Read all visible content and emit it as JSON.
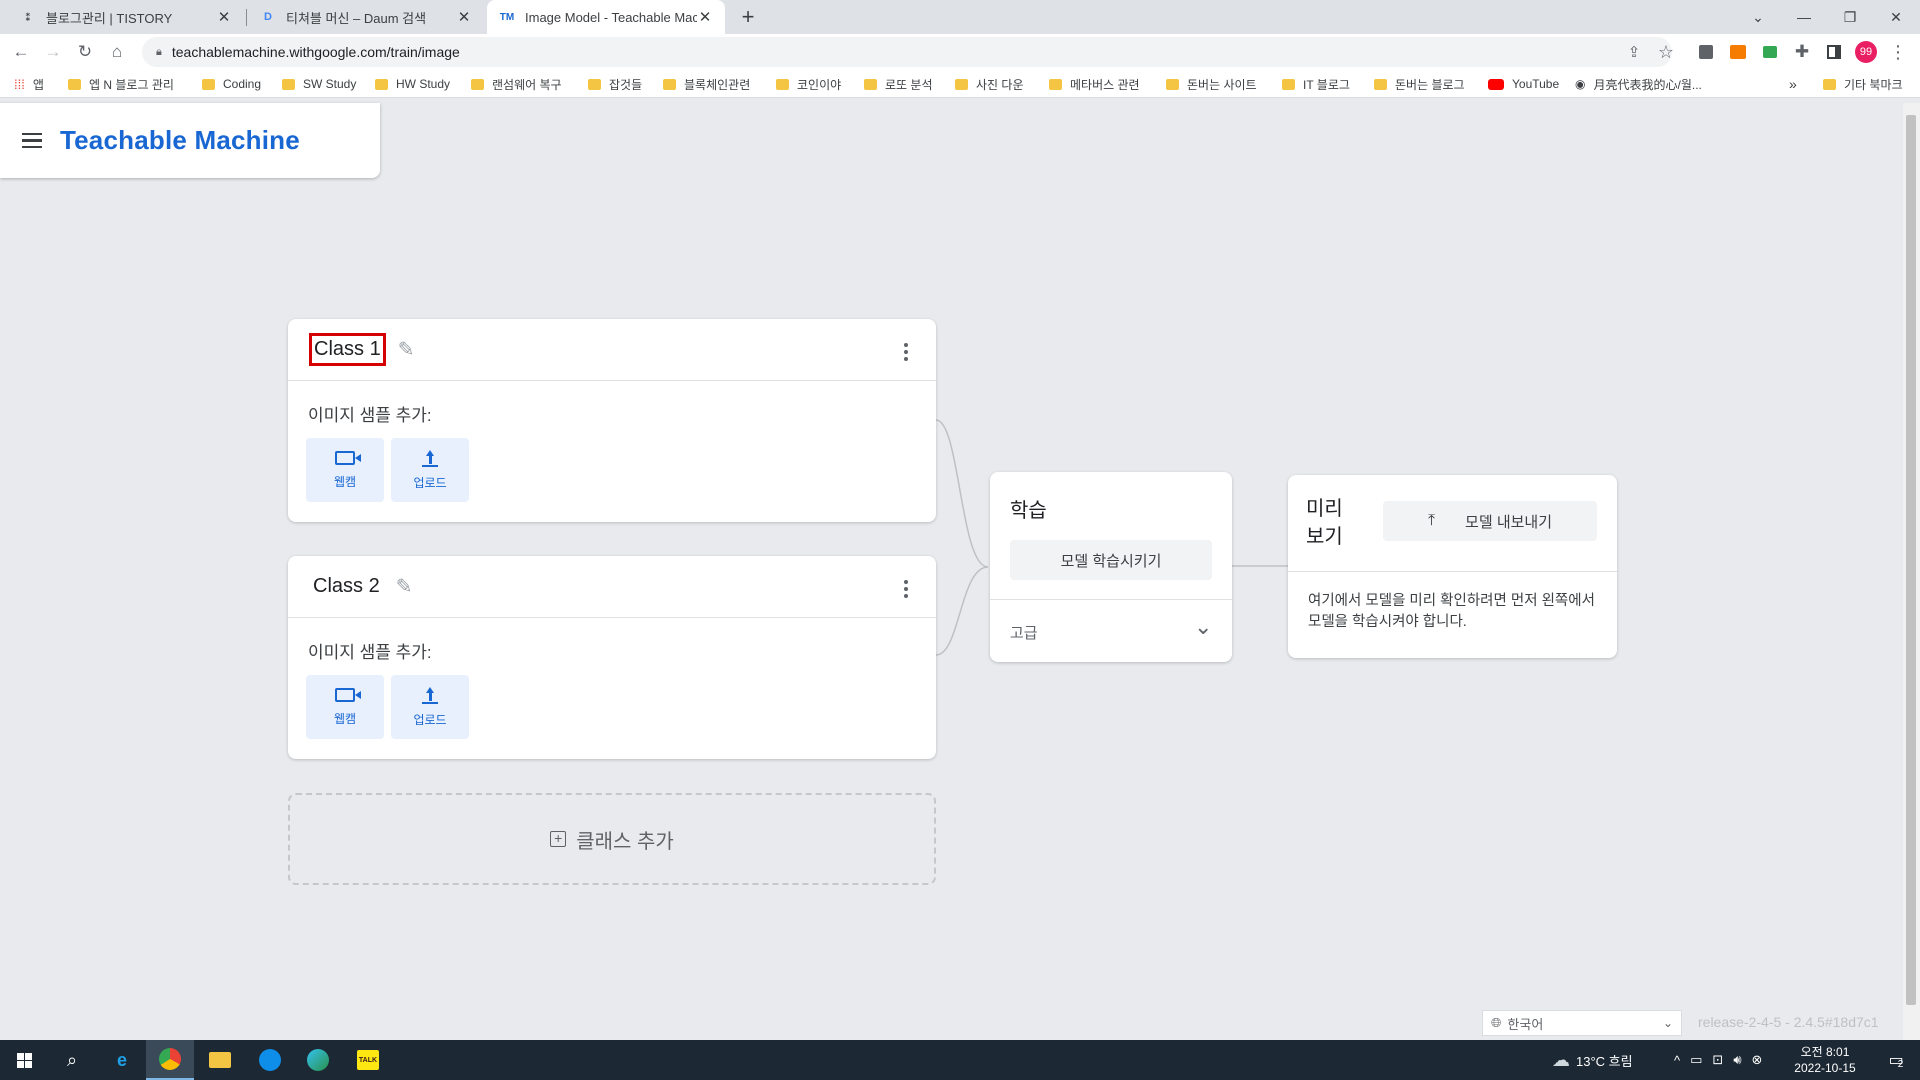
{
  "browser": {
    "tabs": [
      {
        "title": "블로그관리 | TISTORY"
      },
      {
        "title": "티쳐블 머신 – Daum 검색"
      },
      {
        "title": "Image Model - Teachable Mach"
      }
    ],
    "url": "teachablemachine.withgoogle.com/train/image",
    "profile_initials": "99"
  },
  "bookmarks": [
    {
      "label": "앱",
      "icon": "apps-grid-icon"
    },
    {
      "label": "엡 N 블로그 관리",
      "icon": "folder-icon"
    },
    {
      "label": "Coding",
      "icon": "folder-icon"
    },
    {
      "label": "SW Study",
      "icon": "folder-icon"
    },
    {
      "label": "HW Study",
      "icon": "folder-icon"
    },
    {
      "label": "랜섬웨어 복구",
      "icon": "folder-icon"
    },
    {
      "label": "잡것들",
      "icon": "folder-icon"
    },
    {
      "label": "블록체인관련",
      "icon": "folder-icon"
    },
    {
      "label": "코인이야",
      "icon": "folder-icon"
    },
    {
      "label": "로또 분석",
      "icon": "folder-icon"
    },
    {
      "label": "사진 다운",
      "icon": "folder-icon"
    },
    {
      "label": "메타버스 관련",
      "icon": "folder-icon"
    },
    {
      "label": "돈버는 사이트",
      "icon": "folder-icon"
    },
    {
      "label": "IT 블로그",
      "icon": "folder-icon"
    },
    {
      "label": "돈버는 블로그",
      "icon": "folder-icon"
    },
    {
      "label": "YouTube",
      "icon": "youtube-icon"
    },
    {
      "label": "月亮代表我的心/월...",
      "icon": "globe-icon"
    }
  ],
  "bookmarks_overflow": "»",
  "other_bookmarks": "기타 북마크",
  "app": {
    "logo": "Teachable Machine",
    "brand_color": "#1967d2"
  },
  "classes": [
    {
      "name": "Class 1",
      "samples_label": "이미지 샘플 추가:",
      "webcam_label": "웹캠",
      "upload_label": "업로드"
    },
    {
      "name": "Class 2",
      "samples_label": "이미지 샘플 추가:",
      "webcam_label": "웹캠",
      "upload_label": "업로드"
    }
  ],
  "add_class_label": "클래스 추가",
  "training": {
    "title": "학습",
    "train_button": "모델 학습시키기",
    "advanced_label": "고급"
  },
  "preview": {
    "title": "미리 보기",
    "export_button": "모델 내보내기",
    "message": "여기에서 모델을 미리 확인하려면 먼저 왼쪽에서 모델을 학습시켜야 합니다."
  },
  "language": "한국어",
  "release": "release-2-4-5 - 2.4.5#18d7c1",
  "taskbar": {
    "weather": "13°C 흐림",
    "time": "오전 8:01",
    "date": "2022-10-15",
    "notification_count": "2"
  }
}
